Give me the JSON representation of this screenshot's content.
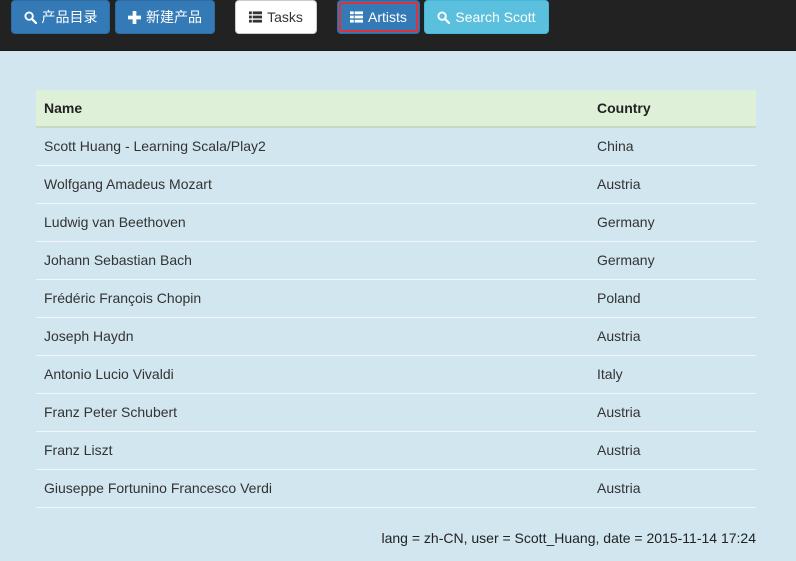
{
  "nav": {
    "product_list_label": "产品目录",
    "new_product_label": "新建产品",
    "tasks_label": "Tasks",
    "artists_label": "Artists",
    "search_label": "Search Scott"
  },
  "table": {
    "headers": {
      "name": "Name",
      "country": "Country"
    },
    "rows": [
      {
        "name": "Scott Huang - Learning Scala/Play2",
        "country": "China"
      },
      {
        "name": "Wolfgang Amadeus Mozart",
        "country": "Austria"
      },
      {
        "name": "Ludwig van Beethoven",
        "country": "Germany"
      },
      {
        "name": "Johann Sebastian Bach",
        "country": "Germany"
      },
      {
        "name": "Frédéric François Chopin",
        "country": "Poland"
      },
      {
        "name": "Joseph Haydn",
        "country": "Austria"
      },
      {
        "name": "Antonio Lucio Vivaldi",
        "country": "Italy"
      },
      {
        "name": "Franz Peter Schubert",
        "country": "Austria"
      },
      {
        "name": "Franz Liszt",
        "country": "Austria"
      },
      {
        "name": "Giuseppe Fortunino Francesco Verdi",
        "country": "Austria"
      }
    ]
  },
  "footer": {
    "text": "lang = zh-CN, user = Scott_Huang, date = 2015-11-14 17:24"
  },
  "colors": {
    "page_bg": "#d1e6ef",
    "navbar_bg": "#222222",
    "primary": "#337ab7",
    "info": "#5bc0de",
    "header_bg": "#dff0d8",
    "active_outline": "#e0313a"
  },
  "icons": {
    "product_list": "search-icon",
    "new_product": "plus-icon",
    "tasks": "list-icon",
    "artists": "table-icon",
    "search": "search-icon"
  }
}
